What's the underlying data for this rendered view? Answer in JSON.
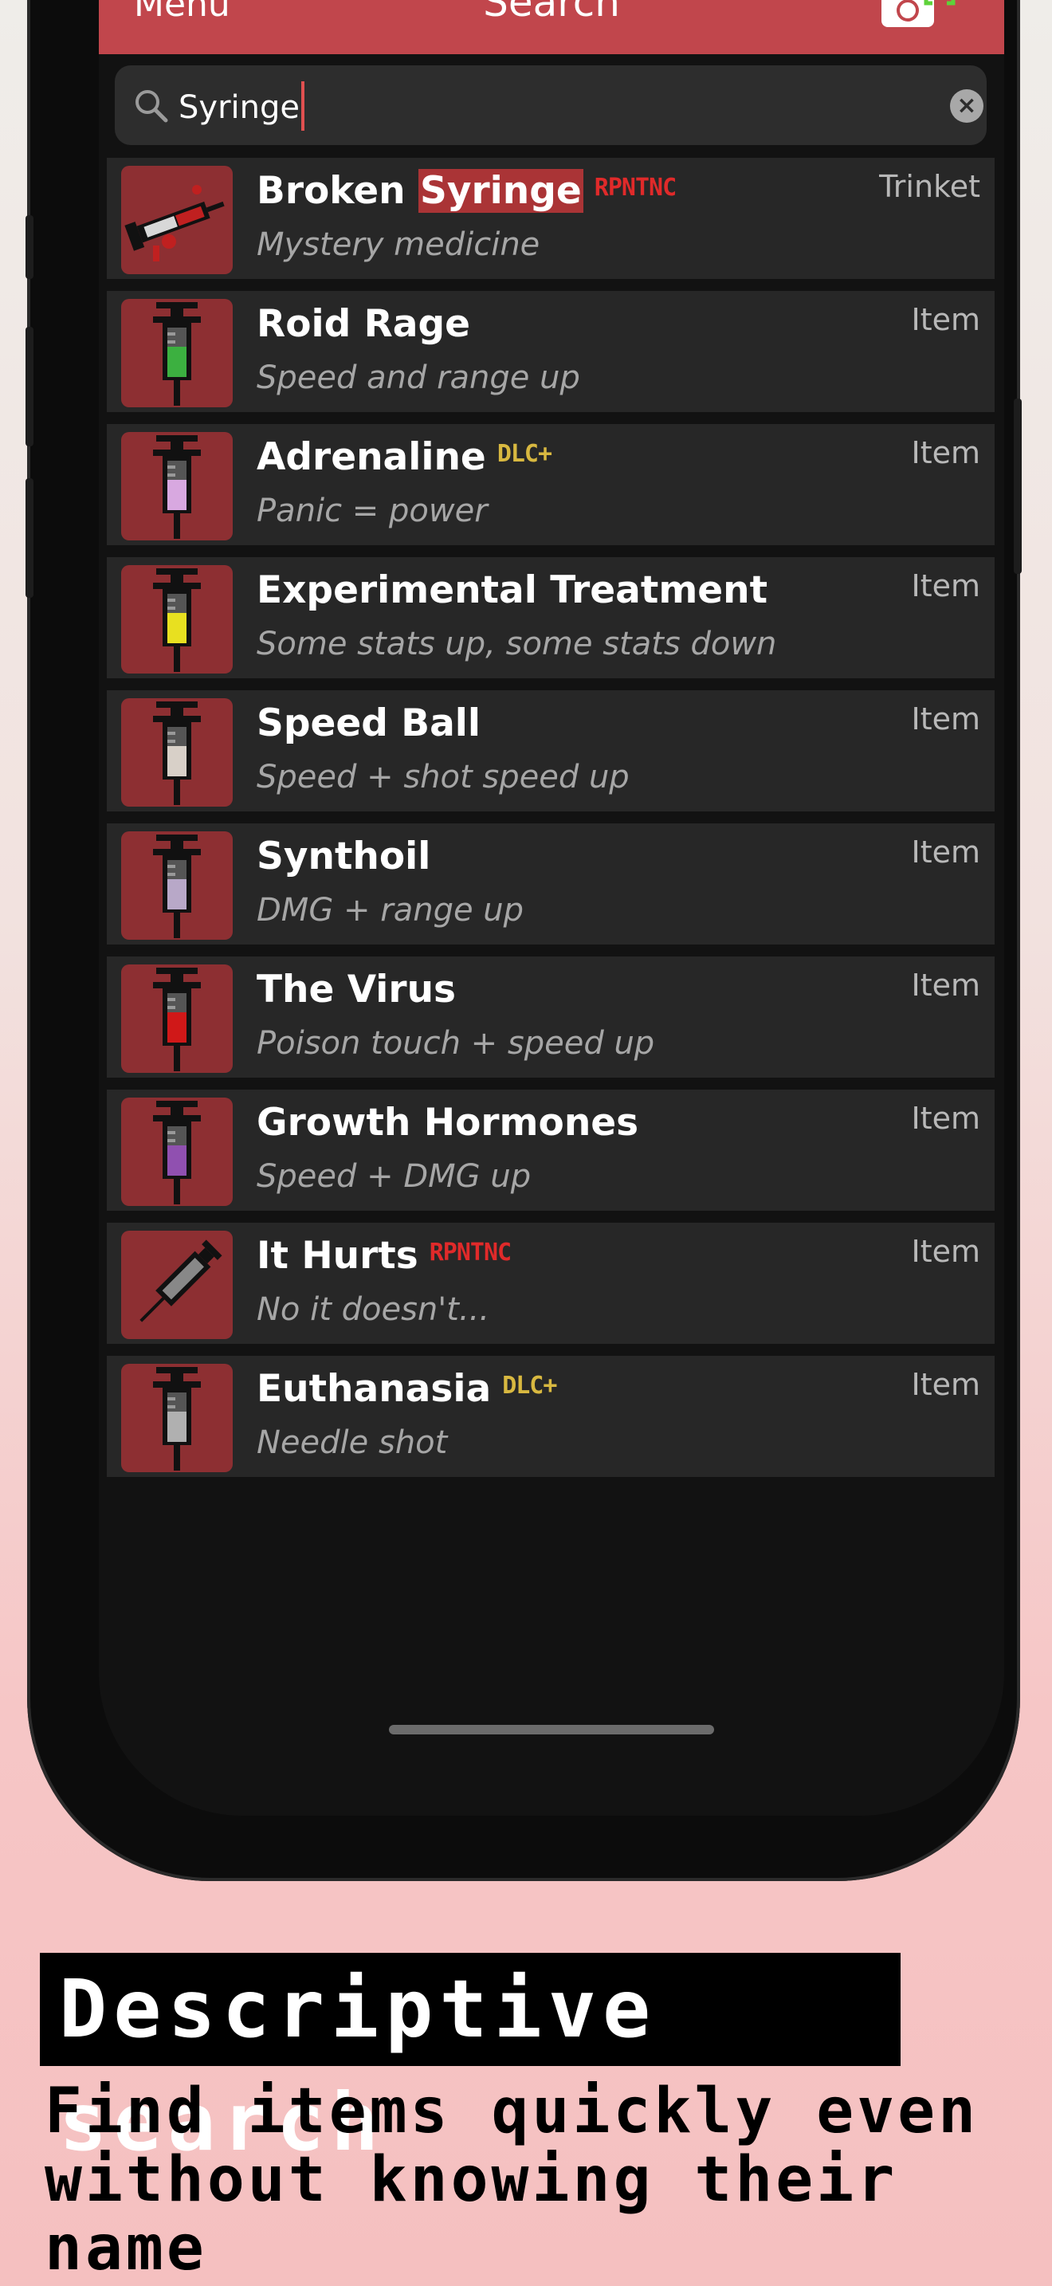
{
  "navbar": {
    "menu_label": "Menu",
    "title": "Search",
    "camera_icon": "camera-scan-icon"
  },
  "search": {
    "value": "Syringe",
    "search_icon": "magnifier-icon",
    "clear_icon": "clear-x-icon"
  },
  "results": [
    {
      "title_pre": "Broken ",
      "title_match": "Syringe",
      "badge": "RPNTNC",
      "badge_type": "repentance",
      "subtitle": "Mystery medicine",
      "type": "Trinket",
      "liquid": "#c02020"
    },
    {
      "title_pre": "Roid Rage",
      "title_match": "",
      "badge": "",
      "badge_type": "",
      "subtitle": "Speed and range up",
      "type": "Item",
      "liquid": "#3cb040"
    },
    {
      "title_pre": "Adrenaline",
      "title_match": "",
      "badge": "DLC+",
      "badge_type": "dlc",
      "subtitle": "Panic = power",
      "type": "Item",
      "liquid": "#d8a8e0"
    },
    {
      "title_pre": "Experimental Treatment",
      "title_match": "",
      "badge": "",
      "badge_type": "",
      "subtitle": "Some stats up, some stats down",
      "type": "Item",
      "liquid": "#e8e020"
    },
    {
      "title_pre": "Speed Ball",
      "title_match": "",
      "badge": "",
      "badge_type": "",
      "subtitle": "Speed + shot speed up",
      "type": "Item",
      "liquid": "#d8d0c8"
    },
    {
      "title_pre": "Synthoil",
      "title_match": "",
      "badge": "",
      "badge_type": "",
      "subtitle": "DMG + range up",
      "type": "Item",
      "liquid": "#b8a8c8"
    },
    {
      "title_pre": "The Virus",
      "title_match": "",
      "badge": "",
      "badge_type": "",
      "subtitle": "Poison touch + speed up",
      "type": "Item",
      "liquid": "#d01818"
    },
    {
      "title_pre": "Growth Hormones",
      "title_match": "",
      "badge": "",
      "badge_type": "",
      "subtitle": "Speed + DMG up",
      "type": "Item",
      "liquid": "#9050b0"
    },
    {
      "title_pre": "It Hurts",
      "title_match": "",
      "badge": "RPNTNC",
      "badge_type": "repentance",
      "subtitle": "No it doesn't...",
      "type": "Item",
      "liquid": "#888888"
    },
    {
      "title_pre": "Euthanasia",
      "title_match": "",
      "badge": "DLC+",
      "badge_type": "dlc",
      "subtitle": "Needle shot",
      "type": "Item",
      "liquid": "#b0b0b0"
    }
  ],
  "caption": {
    "title": "Descriptive search",
    "line1": "Find items quickly even",
    "line2": "without knowing their name"
  }
}
